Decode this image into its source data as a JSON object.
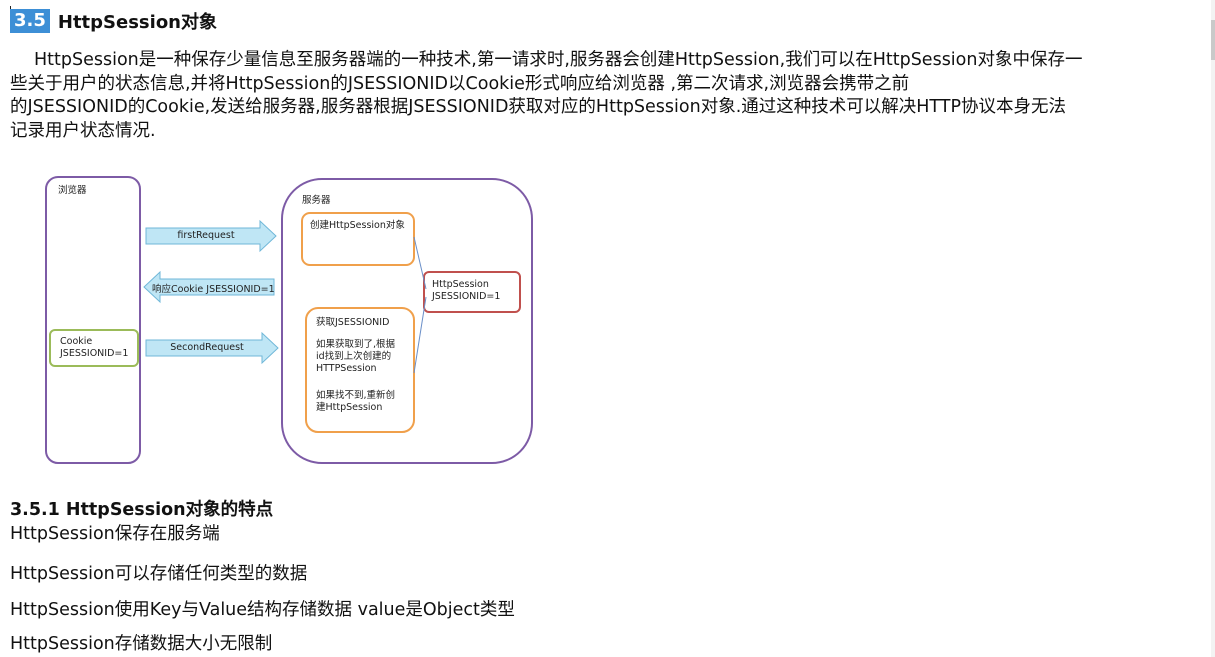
{
  "section": {
    "number": "3.5",
    "title": "HttpSession对象",
    "paragraph_lines": [
      "HttpSession是一种保存少量信息至服务器端的一种技术,第一请求时,服务器会创建HttpSession,我们可以在HttpSession对象中保存一",
      "些关于用户的状态信息,并将HttpSession的JSESSIONID以Cookie形式响应给浏览器 ,第二次请求,浏览器会携带之前",
      "的JSESSIONID的Cookie,发送给服务器,服务器根据JSESSIONID获取对应的HttpSession对象.通过这种技术可以解决HTTP协议本身无法",
      "记录用户状态情况."
    ]
  },
  "diagram": {
    "browser_label": "浏览器",
    "server_label": "服务器",
    "cookie_box": [
      "Cookie",
      "JSESSIONID=1"
    ],
    "arrow_first": "firstRequest",
    "arrow_response": "响应Cookie JSESSIONID=1",
    "arrow_second": "SecondRequest",
    "create_box": "创建HttpSession对象",
    "session_box": [
      "HttpSession",
      "JSESSIONID=1"
    ],
    "get_box": {
      "line1": "获取JSESSIONID",
      "line2": "如果获取到了,根据\nid找到上次创建的\nHTTPSession",
      "line3": "如果找不到,重新创\n建HttpSession"
    },
    "colors": {
      "container": "#7d5ba6",
      "orange": "#f0a04b",
      "red": "#c0504d",
      "green": "#9bbb59",
      "arrow_fill": "#bfe6f5",
      "arrow_stroke": "#6fb7d8",
      "connector": "#6a8fc8"
    }
  },
  "subsection": {
    "title": "3.5.1 HttpSession对象的特点",
    "items": [
      "HttpSession保存在服务端",
      "HttpSession可以存储任何类型的数据",
      "HttpSession使用Key与Value结构存储数据 value是Object类型",
      "HttpSession存储数据大小无限制"
    ]
  }
}
